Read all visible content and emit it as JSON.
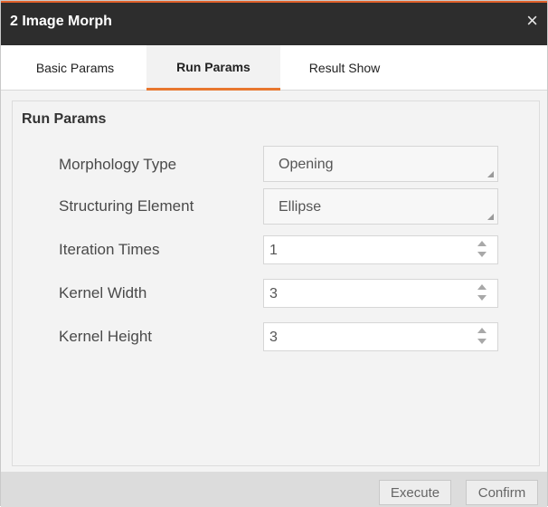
{
  "dialog": {
    "title": "2 Image Morph",
    "close": "×"
  },
  "tabs": [
    {
      "label": "Basic Params",
      "active": false
    },
    {
      "label": "Run Params",
      "active": true
    },
    {
      "label": "Result Show",
      "active": false
    }
  ],
  "section": {
    "title": "Run Params"
  },
  "params": {
    "morphology_type": {
      "label": "Morphology Type",
      "value": "Opening"
    },
    "structuring_element": {
      "label": "Structuring Element",
      "value": "Ellipse"
    },
    "iteration_times": {
      "label": "Iteration Times",
      "value": "1"
    },
    "kernel_width": {
      "label": "Kernel Width",
      "value": "3"
    },
    "kernel_height": {
      "label": "Kernel Height",
      "value": "3"
    }
  },
  "buttons": {
    "execute": "Execute",
    "confirm": "Confirm"
  },
  "colors": {
    "titlebar": "#2d2d2d",
    "accent": "#e8772f"
  }
}
